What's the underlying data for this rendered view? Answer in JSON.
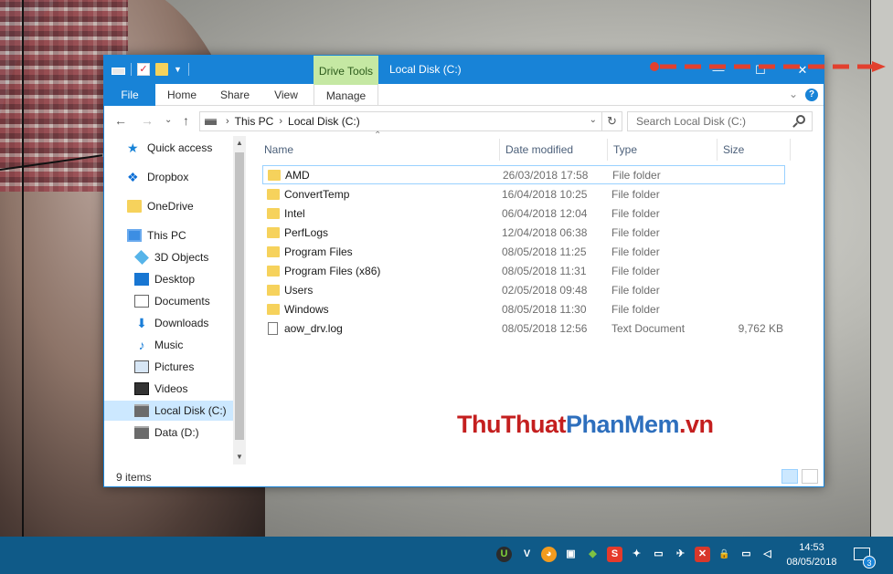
{
  "titlebar": {
    "context_tab": "Drive Tools",
    "title": "Local Disk (C:)",
    "minimize": "—",
    "maximize": "☐",
    "close": "✕"
  },
  "ribbon": {
    "tabs": [
      "File",
      "Home",
      "Share",
      "View",
      "Manage"
    ],
    "help": "?"
  },
  "address": {
    "crumbs": [
      "This PC",
      "Local Disk (C:)"
    ],
    "search_placeholder": "Search Local Disk (C:)"
  },
  "nav_pane": {
    "items": [
      {
        "label": "Quick access",
        "icon": "star-icon"
      },
      {
        "label": "Dropbox",
        "icon": "dropbox-icon"
      },
      {
        "label": "OneDrive",
        "icon": "folder-icon"
      },
      {
        "label": "This PC",
        "icon": "computer-icon"
      },
      {
        "label": "3D Objects",
        "icon": "cube-icon"
      },
      {
        "label": "Desktop",
        "icon": "desktop-icon"
      },
      {
        "label": "Documents",
        "icon": "documents-icon"
      },
      {
        "label": "Downloads",
        "icon": "downloads-icon"
      },
      {
        "label": "Music",
        "icon": "music-icon"
      },
      {
        "label": "Pictures",
        "icon": "pictures-icon"
      },
      {
        "label": "Videos",
        "icon": "videos-icon"
      },
      {
        "label": "Local Disk (C:)",
        "icon": "drive-icon"
      },
      {
        "label": "Data (D:)",
        "icon": "drive-icon"
      }
    ],
    "selected": "Local Disk (C:)"
  },
  "file_list": {
    "columns": [
      "Name",
      "Date modified",
      "Type",
      "Size"
    ],
    "rows": [
      {
        "name": "AMD",
        "date": "26/03/2018 17:58",
        "type": "File folder",
        "size": ""
      },
      {
        "name": "ConvertTemp",
        "date": "16/04/2018 10:25",
        "type": "File folder",
        "size": ""
      },
      {
        "name": "Intel",
        "date": "06/04/2018 12:04",
        "type": "File folder",
        "size": ""
      },
      {
        "name": "PerfLogs",
        "date": "12/04/2018 06:38",
        "type": "File folder",
        "size": ""
      },
      {
        "name": "Program Files",
        "date": "08/05/2018 11:25",
        "type": "File folder",
        "size": ""
      },
      {
        "name": "Program Files (x86)",
        "date": "08/05/2018 11:31",
        "type": "File folder",
        "size": ""
      },
      {
        "name": "Users",
        "date": "02/05/2018 09:48",
        "type": "File folder",
        "size": ""
      },
      {
        "name": "Windows",
        "date": "08/05/2018 11:30",
        "type": "File folder",
        "size": ""
      },
      {
        "name": "aow_drv.log",
        "date": "08/05/2018 12:56",
        "type": "Text Document",
        "size": "9,762 KB"
      }
    ]
  },
  "status": {
    "item_count": "9 items"
  },
  "watermark": {
    "part1": "ThuThuat",
    "part2": "PhanMem",
    "part3": ".vn"
  },
  "taskbar": {
    "time": "14:53",
    "date": "08/05/2018",
    "notification_count": "3",
    "tray_icons": [
      "utorrent-icon",
      "vivaldi-icon",
      "browser-icon",
      "network-share-icon",
      "shield-icon",
      "snagit-icon",
      "dropbox-icon",
      "usb-icon",
      "cloud-off-icon",
      "remote-icon",
      "lock-icon",
      "network-icon",
      "volume-mute-icon"
    ],
    "tray_glyphs": [
      "U",
      "V",
      "◕",
      "▣",
      "◆",
      "S",
      "✦",
      "▭",
      "✈",
      "✕",
      "🔒",
      "▭",
      "◁"
    ]
  },
  "colors": {
    "accent": "#1883d7",
    "drive_tools": "#c5e8a3",
    "folder": "#f6d25c",
    "selection": "#cce8ff",
    "taskbar": "#0f5a88",
    "arrow": "#e2402e"
  }
}
